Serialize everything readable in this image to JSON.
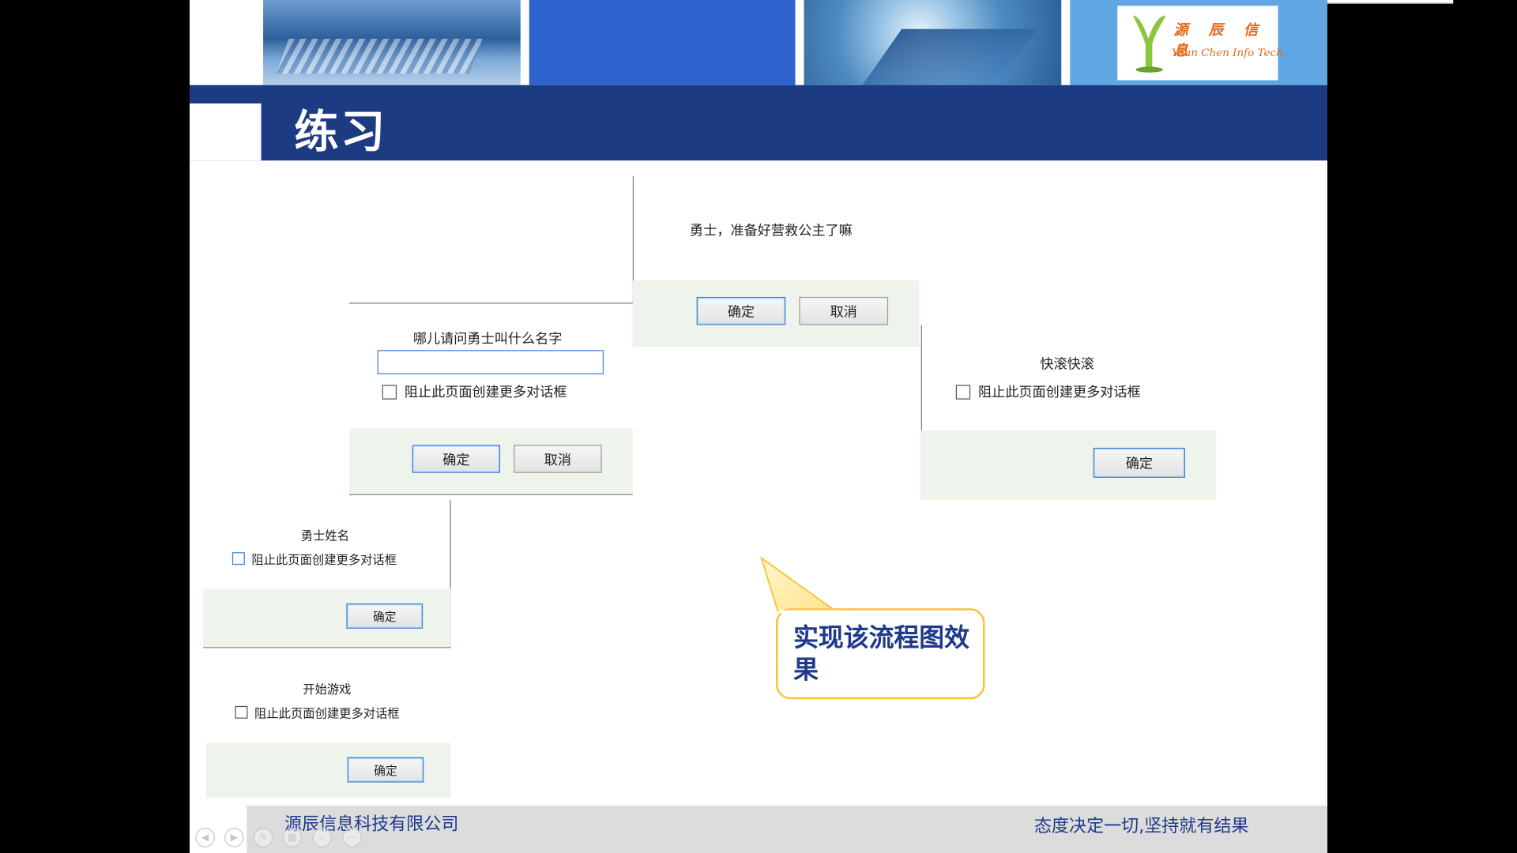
{
  "slide": {
    "title": "练习",
    "logo": {
      "mark": "Y",
      "chinese": "源 辰 信 息",
      "english": "Yuan Chen Info Tech."
    },
    "callout": "实现该流程图效果"
  },
  "dialogs": {
    "prepare": {
      "message": "勇士，准备好营救公主了嘛",
      "ok_label": "确定",
      "cancel_label": "取消"
    },
    "name_prompt": {
      "message": "哪儿请问勇士叫什么名字",
      "input_value": "",
      "checkbox_label": "阻止此页面创建更多对话框",
      "ok_label": "确定",
      "cancel_label": "取消"
    },
    "scram": {
      "message": "快滚快滚",
      "checkbox_label": "阻止此页面创建更多对话框",
      "ok_label": "确定"
    },
    "warrior_name": {
      "message": "勇士姓名",
      "checkbox_label": "阻止此页面创建更多对话框",
      "ok_label": "确定"
    },
    "start_game": {
      "message": "开始游戏",
      "checkbox_label": "阻止此页面创建更多对话框",
      "ok_label": "确定"
    }
  },
  "footer": {
    "company": "源辰信息科技有限公司",
    "slogan": "态度决定一切,坚持就有结果"
  },
  "player_controls": [
    "previous-icon",
    "next-icon",
    "pen-icon",
    "slides-icon",
    "zoom-icon",
    "more-icon"
  ],
  "colors": {
    "title_bar": "#1c3b82",
    "footer_text": "#1e3a8a",
    "callout_fill": "#ffffff",
    "callout_border": "#f6c431",
    "logo_orange": "#e66a1a",
    "logo_green": "#8cc63f"
  }
}
